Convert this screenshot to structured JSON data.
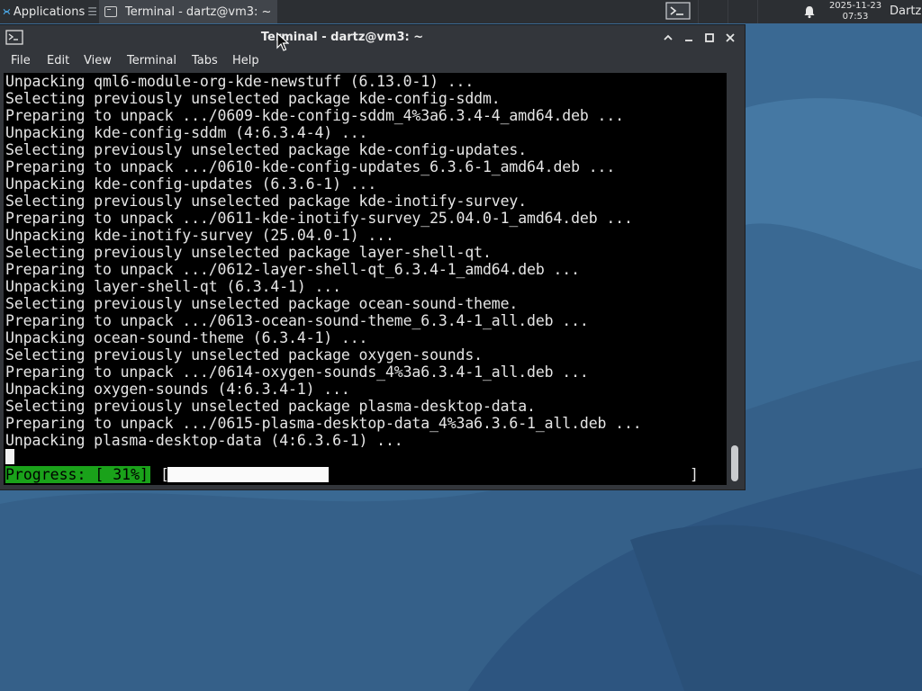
{
  "panel": {
    "apps_label": "Applications",
    "apps_shortcut": "☰",
    "task_label": "Terminal - dartz@vm3: ~",
    "clock_date": "2025-11-23",
    "clock_time": "07:53",
    "user": "Dartz"
  },
  "window": {
    "title": "Terminal - dartz@vm3: ~",
    "menu": [
      "File",
      "Edit",
      "View",
      "Terminal",
      "Tabs",
      "Help"
    ]
  },
  "terminal": {
    "lines": [
      "Unpacking qml6-module-org-kde-newstuff (6.13.0-1) ...",
      "Selecting previously unselected package kde-config-sddm.",
      "Preparing to unpack .../0609-kde-config-sddm_4%3a6.3.4-4_amd64.deb ...",
      "Unpacking kde-config-sddm (4:6.3.4-4) ...",
      "Selecting previously unselected package kde-config-updates.",
      "Preparing to unpack .../0610-kde-config-updates_6.3.6-1_amd64.deb ...",
      "Unpacking kde-config-updates (6.3.6-1) ...",
      "Selecting previously unselected package kde-inotify-survey.",
      "Preparing to unpack .../0611-kde-inotify-survey_25.04.0-1_amd64.deb ...",
      "Unpacking kde-inotify-survey (25.04.0-1) ...",
      "Selecting previously unselected package layer-shell-qt.",
      "Preparing to unpack .../0612-layer-shell-qt_6.3.4-1_amd64.deb ...",
      "Unpacking layer-shell-qt (6.3.4-1) ...",
      "Selecting previously unselected package ocean-sound-theme.",
      "Preparing to unpack .../0613-ocean-sound-theme_6.3.4-1_all.deb ...",
      "Unpacking ocean-sound-theme (6.3.4-1) ...",
      "Selecting previously unselected package oxygen-sounds.",
      "Preparing to unpack .../0614-oxygen-sounds_4%3a6.3.4-1_all.deb ...",
      "Unpacking oxygen-sounds (4:6.3.4-1) ...",
      "Selecting previously unselected package plasma-desktop-data.",
      "Preparing to unpack .../0615-plasma-desktop-data_4%3a6.3.6-1_all.deb ...",
      "Unpacking plasma-desktop-data (4:6.3.6-1) ..."
    ],
    "progress_label": "Progress: [ 31%]",
    "progress_left_bracket": "[",
    "progress_right_bracket": "]",
    "progress_fraction": 0.31
  },
  "colors": {
    "progress_label_bg": "#1aa21a",
    "panel_bg": "#2c2f33",
    "window_bg": "#33363b",
    "terminal_bg": "#000000"
  }
}
